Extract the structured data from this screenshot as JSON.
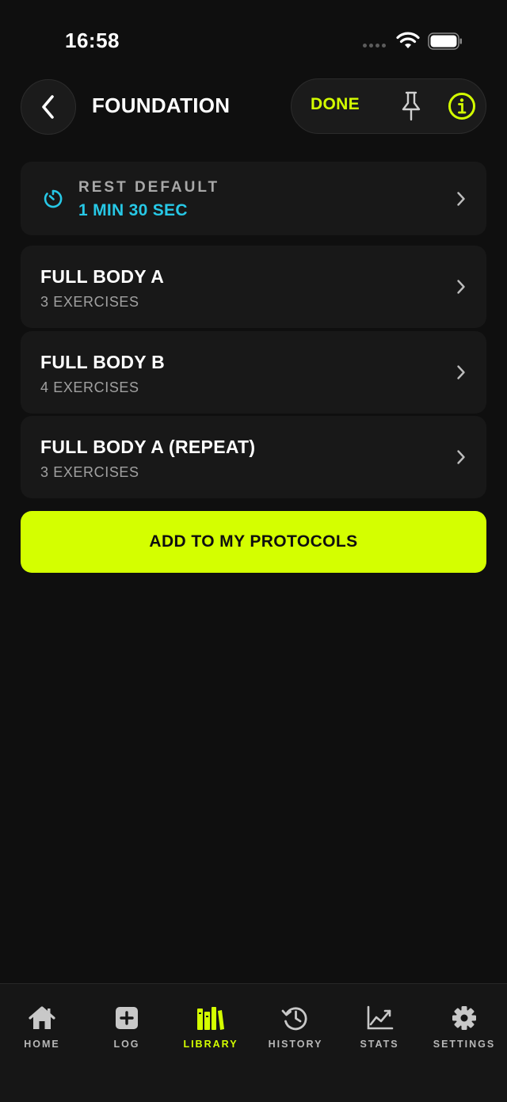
{
  "status_bar": {
    "time": "16:58"
  },
  "header": {
    "title": "FOUNDATION",
    "done_label": "DONE"
  },
  "rest": {
    "label": "REST DEFAULT",
    "value": "1 MIN 30 SEC"
  },
  "workouts": [
    {
      "title": "FULL BODY A",
      "subtitle": "3 EXERCISES"
    },
    {
      "title": "FULL BODY B",
      "subtitle": "4 EXERCISES"
    },
    {
      "title": "FULL BODY A (REPEAT)",
      "subtitle": "3 EXERCISES"
    }
  ],
  "add_button_label": "ADD TO MY PROTOCOLS",
  "tabs": [
    {
      "label": "HOME",
      "icon": "home-icon"
    },
    {
      "label": "LOG",
      "icon": "plus-square-icon"
    },
    {
      "label": "LIBRARY",
      "icon": "library-icon",
      "active": true
    },
    {
      "label": "HISTORY",
      "icon": "history-icon"
    },
    {
      "label": "STATS",
      "icon": "chart-icon"
    },
    {
      "label": "SETTINGS",
      "icon": "gear-icon"
    }
  ],
  "colors": {
    "accent": "#d4ff00",
    "rest_value": "#27c8e6",
    "background": "#0f0f0f",
    "card": "#181818"
  }
}
